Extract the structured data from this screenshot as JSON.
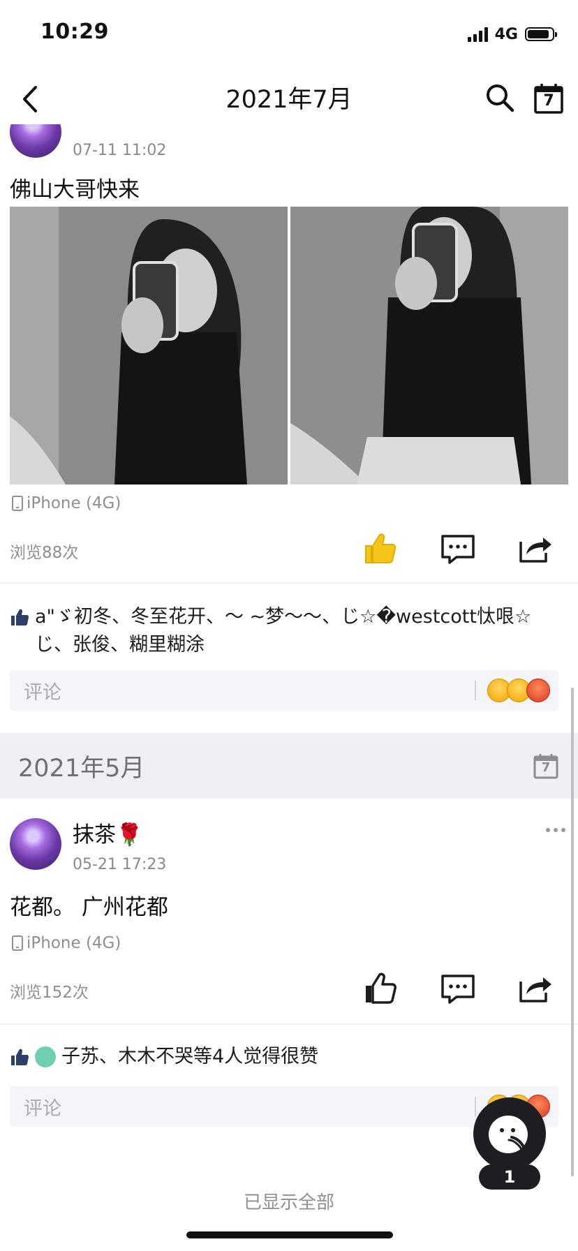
{
  "status_bar": {
    "time": "10:29",
    "network": "4G"
  },
  "nav": {
    "title": "2021年7月",
    "calendar_day": "7"
  },
  "post1": {
    "time": "07-11 11:02",
    "text": "佛山大哥快来",
    "device": "iPhone (4G)",
    "views": "浏览88次",
    "liked": true,
    "likes_text": "a\"ゞ初冬、冬至花开、～ ~梦～～、じ☆�westcott忲哏☆じ、张俊、糊里糊涂",
    "comment_placeholder": "评论"
  },
  "section": {
    "month": "2021年5月",
    "calendar_day": "7"
  },
  "post2": {
    "author": "抹茶🌹",
    "time": "05-21 17:23",
    "text": "花都。 广州花都",
    "device": "iPhone (4G)",
    "views": "浏览152次",
    "liked": false,
    "likes_text": "子苏、木木不哭等4人觉得很赞",
    "comment_placeholder": "评论"
  },
  "footer": {
    "text": "已显示全部"
  },
  "float_button": {
    "badge": "1"
  },
  "colors": {
    "like_active": "#f5c518",
    "icon_dark": "#1c1c1e",
    "like_blue": "#2c3e69"
  }
}
